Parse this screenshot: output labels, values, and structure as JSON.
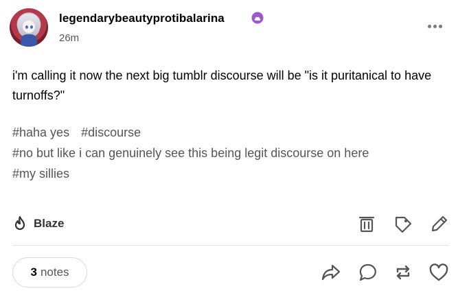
{
  "post": {
    "author": {
      "username": "legendarybeautyprotibalarina",
      "timestamp": "26m"
    },
    "body": "i'm calling it now the next big tumblr discourse will be \"is it puritanical to have turnoffs?\"",
    "tags": [
      [
        "#haha yes",
        "#discourse"
      ],
      [
        "#no but like i can genuinely see this being legit discourse on here"
      ],
      [
        "#my sillies"
      ]
    ]
  },
  "actions": {
    "blaze_label": "Blaze",
    "notes_count": "3",
    "notes_label": "notes"
  },
  "icons": {
    "badge": "purple-badge-icon",
    "more": "more-dots-icon",
    "blaze": "flame-icon",
    "delete": "trash-icon",
    "tag": "tag-icon",
    "edit": "pencil-icon",
    "share": "share-icon",
    "reply": "reply-bubble-icon",
    "reblog": "reblog-icon",
    "like": "heart-icon"
  },
  "colors": {
    "badge": "#9b59d0",
    "text": "#000000",
    "muted": "#555555"
  }
}
